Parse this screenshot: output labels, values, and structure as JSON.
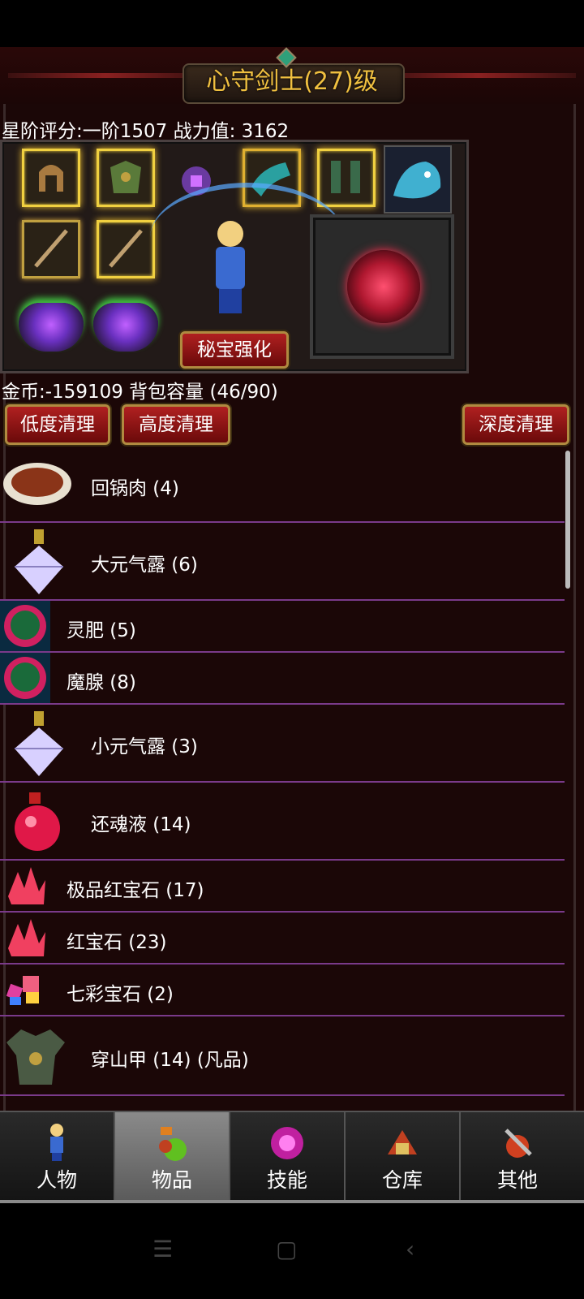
{
  "title": "心守剑士(27)级",
  "stats_line": "星阶评分:一阶1507 战力值: 3162",
  "secret_button": "秘宝强化",
  "gold_line": "金币:-159109 背包容量 (46/90)",
  "clean_buttons": [
    "低度清理",
    "高度清理",
    "深度清理"
  ],
  "items": [
    {
      "label": "回锅肉 (4)",
      "icon": "braised-pork-icon"
    },
    {
      "label": "大元气露 (6)",
      "icon": "crystal-flask-icon"
    },
    {
      "label": "灵肥 (5)",
      "icon": "green-orb-icon"
    },
    {
      "label": "魔腺 (8)",
      "icon": "green-orb-icon"
    },
    {
      "label": "小元气露 (3)",
      "icon": "crystal-flask-icon"
    },
    {
      "label": "还魂液 (14)",
      "icon": "red-potion-icon"
    },
    {
      "label": "极品红宝石 (17)",
      "icon": "red-gem-icon"
    },
    {
      "label": "红宝石 (23)",
      "icon": "red-gem-icon"
    },
    {
      "label": "七彩宝石 (2)",
      "icon": "rainbow-gem-icon"
    },
    {
      "label": "穿山甲 (14) (凡品)",
      "icon": "armor-icon"
    }
  ],
  "tabs": [
    {
      "label": "人物",
      "icon": "character-icon"
    },
    {
      "label": "物品",
      "icon": "potion-bag-icon"
    },
    {
      "label": "技能",
      "icon": "skill-orb-icon"
    },
    {
      "label": "仓库",
      "icon": "warehouse-icon"
    },
    {
      "label": "其他",
      "icon": "other-tools-icon"
    }
  ],
  "active_tab": "物品",
  "colors": {
    "title_gold": "#f0c040",
    "item_divider": "#7a3a8a",
    "button_red": "#b02020",
    "frame_bg": "#1b0606"
  }
}
